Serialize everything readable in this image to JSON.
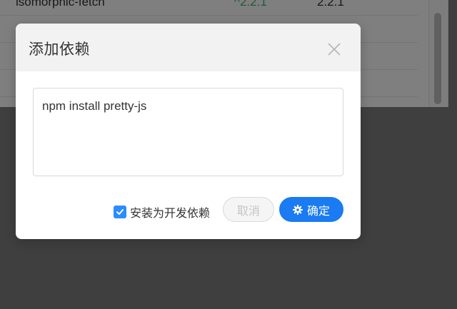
{
  "background": {
    "rows": [
      {
        "name": "isomorphic-fetch",
        "range": "^2.2.1",
        "version": "2.2.1"
      }
    ]
  },
  "dialog": {
    "title": "添加依赖",
    "textarea_value": "npm install pretty-js",
    "checkbox_label": "安装为开发依赖",
    "checkbox_checked": true,
    "cancel_label": "取消",
    "ok_label": "确定"
  },
  "colors": {
    "primary": "#1a7bf2",
    "checkbox": "#2b8cff",
    "range_green": "#3cb371"
  },
  "icons": {
    "close": "close-icon",
    "ok": "gear-icon",
    "check": "check-icon"
  }
}
